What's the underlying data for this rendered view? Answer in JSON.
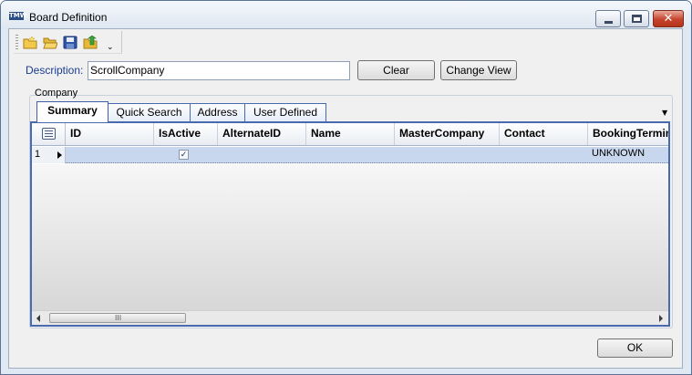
{
  "window": {
    "title": "Board Definition",
    "app_icon_text": "TMW",
    "controls": {
      "minimize": "minimize",
      "maximize": "maximize",
      "close": "✕"
    }
  },
  "toolbar": {
    "icons": [
      "new-folder-icon",
      "open-folder-icon",
      "save-disk-icon",
      "export-icon"
    ],
    "dropdown_glyph": "⌄"
  },
  "description": {
    "label": "Description:",
    "value": "ScrollCompany"
  },
  "buttons": {
    "clear": "Clear",
    "change_view": "Change View",
    "ok": "OK"
  },
  "group": {
    "label": "Company",
    "tabs": [
      "Summary",
      "Quick Search",
      "Address",
      "User Defined"
    ],
    "active_tab": "Summary",
    "tab_menu_glyph": "▼"
  },
  "grid": {
    "columns": [
      "ID",
      "IsActive",
      "AlternateID",
      "Name",
      "MasterCompany",
      "Contact",
      "BookingTermin"
    ],
    "rows": [
      {
        "row_number": "1",
        "ID": "",
        "IsActive": "✓",
        "AlternateID": "",
        "Name": "",
        "MasterCompany": "",
        "Contact": "",
        "BookingTermin": "UNKNOWN"
      }
    ],
    "scrollbar_grip": "III"
  },
  "colors": {
    "accent": "#4a6ab0",
    "selected_row": "#c8d7ee",
    "label_blue": "#1a3d8f"
  }
}
